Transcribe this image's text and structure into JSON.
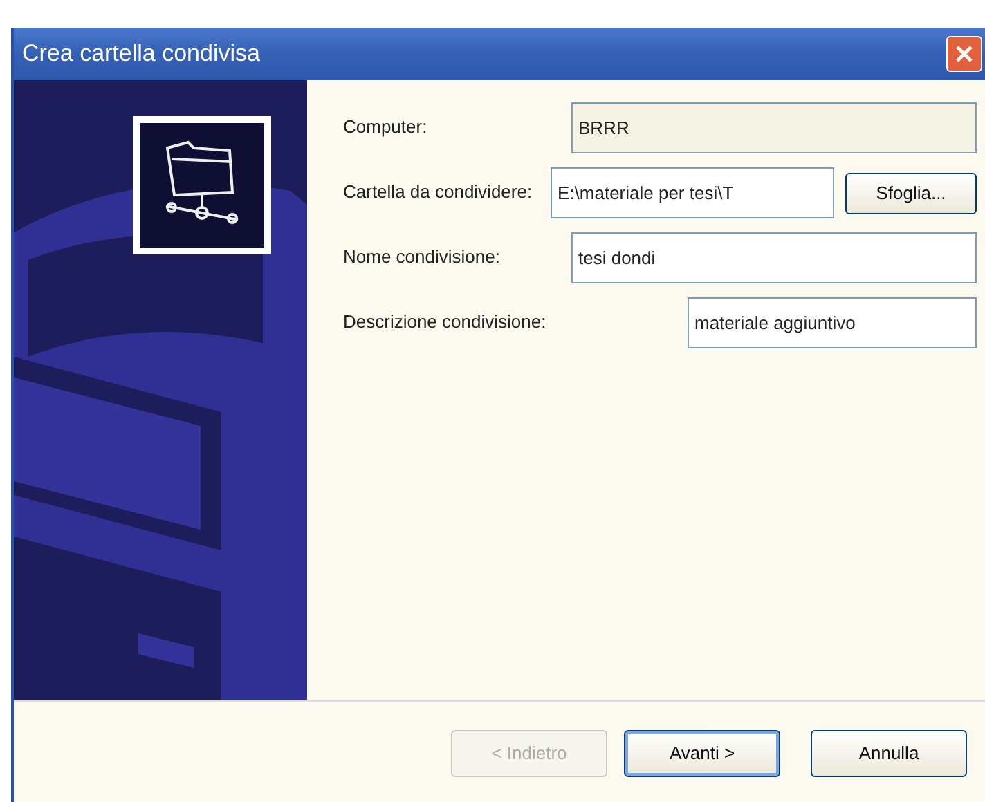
{
  "window": {
    "title": "Crea cartella condivisa"
  },
  "fields": [
    {
      "label": "Computer:",
      "value": "BRRR",
      "readonly": true
    },
    {
      "label": "Cartella da condividere:",
      "value": "E:\\materiale per tesi\\T",
      "readonly": false,
      "button": "Sfoglia..."
    },
    {
      "label": "Nome condivisione:",
      "value": "tesi dondi",
      "readonly": false
    },
    {
      "label": "Descrizione condivisione:",
      "value": "materiale aggiuntivo",
      "readonly": false
    }
  ],
  "buttons": [
    {
      "label": "< Indietro",
      "disabled": true,
      "default": false
    },
    {
      "label": "Avanti >",
      "disabled": false,
      "default": true
    },
    {
      "label": "Annulla",
      "disabled": false,
      "default": false
    }
  ]
}
